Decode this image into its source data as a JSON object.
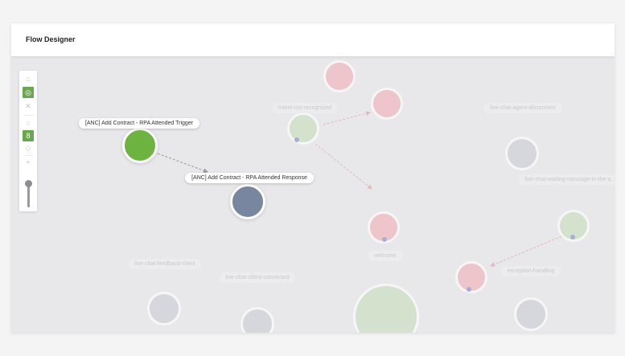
{
  "app": {
    "title": "Flow Designer"
  },
  "colors": {
    "green_active": "#6db33f",
    "navy_active": "#7886a0",
    "green_faded": "#d4e1cd",
    "red_faded": "#eec5ca",
    "gray_faded": "#d6d7dd",
    "edge_active": "#9a9a9e",
    "edge_faded": "#e3b8bd",
    "dot": "#a9aed8"
  },
  "toolbar": {
    "tools": [
      {
        "name": "home-icon",
        "glyph": "⌂",
        "active": false
      },
      {
        "name": "fit-view-icon",
        "glyph": "◎",
        "active": true
      },
      {
        "name": "shrink-icon",
        "glyph": "✕",
        "active": false
      },
      {
        "name": "circle-layout-icon",
        "glyph": "○",
        "active": false
      },
      {
        "name": "node-toggle-icon",
        "glyph": "8",
        "active": true
      },
      {
        "name": "eraser-icon",
        "glyph": "◇",
        "active": false
      },
      {
        "name": "zoom-in-icon",
        "glyph": "+",
        "active": false
      }
    ],
    "zoom_level": 1
  },
  "nodes": {
    "trigger": {
      "label": "[ANC] Add Contract - RPA Attended Trigger"
    },
    "response": {
      "label": "[ANC] Add Contract - RPA Attended Response"
    },
    "intent_not_recognized": {
      "label": "Intent-not-recognized"
    },
    "agent_disconnect": {
      "label": "live-chat-agent-disconnect"
    },
    "waiting_message": {
      "label": "live-chat-waiting-message-in-the-q"
    },
    "feedback_client": {
      "label": "live-chat-feedback-client"
    },
    "client_connected": {
      "label": "live-chat-client-connected"
    },
    "welcome": {
      "label": "welcome"
    },
    "exception_handling": {
      "label": "exception-handling"
    }
  }
}
